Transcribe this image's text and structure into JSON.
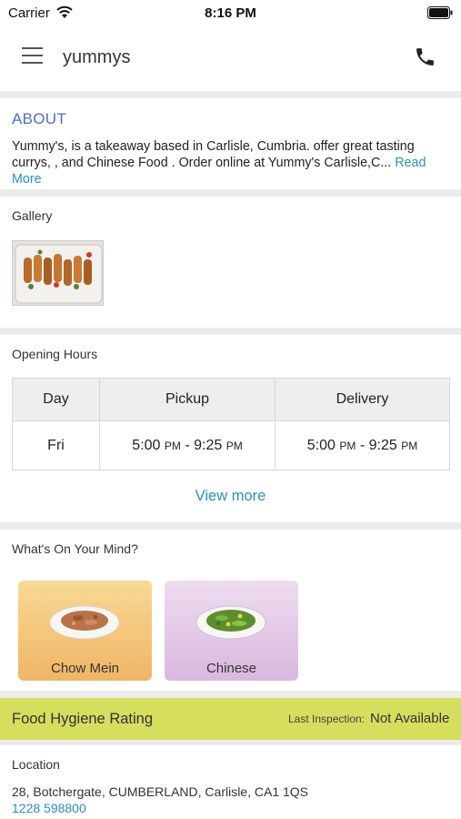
{
  "status_bar": {
    "carrier": "Carrier",
    "time": "8:16 PM"
  },
  "header": {
    "title": "yummys",
    "menu_icon": "hamburger-menu-icon",
    "call_icon": "phone-icon"
  },
  "about": {
    "heading": "ABOUT",
    "text": "Yummy's, is a takeaway based in Carlisle, Cumbria. offer great tasting currys, , and Chinese Food . Order online at Yummy's Carlisle,C...",
    "read_more": "Read More"
  },
  "gallery": {
    "heading": "Gallery"
  },
  "opening_hours": {
    "heading": "Opening Hours",
    "columns": [
      "Day",
      "Pickup",
      "Delivery"
    ],
    "rows": [
      {
        "day": "Fri",
        "pickup_open": "5:00",
        "pickup_open_ampm": "PM",
        "pickup_sep": " - ",
        "pickup_close": "9:25",
        "pickup_close_ampm": "PM",
        "delivery_open": "5:00",
        "delivery_open_ampm": "PM",
        "delivery_sep": " - ",
        "delivery_close": "9:25",
        "delivery_close_ampm": "PM"
      }
    ],
    "view_more": "View more"
  },
  "categories": {
    "heading": "What's On Your Mind?",
    "items": [
      {
        "label": "Chow Mein"
      },
      {
        "label": "Chinese"
      }
    ]
  },
  "hygiene": {
    "title": "Food Hygiene Rating",
    "last_inspection_label": "Last Inspection:",
    "last_inspection_value": "Not Available"
  },
  "location": {
    "heading": "Location",
    "address": "28, Botchergate, CUMBERLAND, Carlisle, CA1 1QS",
    "phone": "1228 598800"
  },
  "colors": {
    "accent_blue": "#4f6ad0",
    "link_blue": "#2a8fc4",
    "hygiene_bar": "#d6de5d",
    "chow_mein_card": "#f0b565",
    "chinese_card": "#d9b8df"
  }
}
